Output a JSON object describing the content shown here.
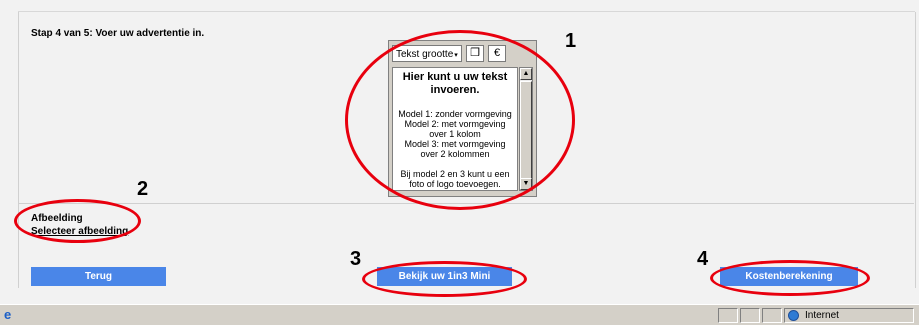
{
  "step": {
    "title": "Stap 4 van 5: Voer uw advertentie in."
  },
  "editor": {
    "toolbar": {
      "text_size_label": "Tekst grootte",
      "caret": "▾",
      "icon_symbol": "❒",
      "euro_symbol": "€"
    },
    "heading_line1": "Hier kunt u uw tekst",
    "heading_line2": "invoeren.",
    "body_lines": [
      "Model 1: zonder vormgeving",
      "Model 2: met vormgeving",
      "over 1 kolom",
      "Model 3: met vormgeving",
      "over 2 kolommen"
    ],
    "note_lines": [
      "Bij model 2 en 3 kunt u een",
      "foto of logo toevoegen."
    ],
    "scroll_up": "▲",
    "scroll_down": "▼"
  },
  "image_section": {
    "label": "Afbeelding",
    "link": "Selecteer afbeelding"
  },
  "buttons": {
    "back": "Terug",
    "mini": "Bekijk uw 1in3 Mini",
    "cost": "Kostenberekening"
  },
  "annotations": {
    "n1": "1",
    "n2": "2",
    "n3": "3",
    "n4": "4",
    "color": "#e8000e"
  },
  "statusbar": {
    "zone": "Internet",
    "ie_icon": "e"
  },
  "colors": {
    "button": "#4a86e8",
    "annotation": "#e8000e",
    "background": "#f2f2f2"
  }
}
